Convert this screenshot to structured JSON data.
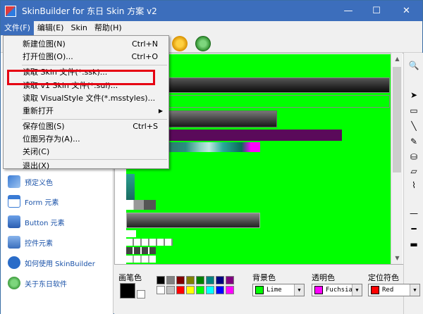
{
  "window": {
    "title": "SkinBuilder for 东日 Skin 方案 v2",
    "minimize": "—",
    "maximize": "☐",
    "close": "✕"
  },
  "menubar": {
    "items": [
      "文件(F)",
      "编辑(E)",
      "Skin",
      "帮助(H)"
    ]
  },
  "file_menu": {
    "items": [
      {
        "label": "新建位图(N)",
        "shortcut": "Ctrl+N"
      },
      {
        "label": "打开位图(O)...",
        "shortcut": "Ctrl+O"
      },
      {
        "label": "读取 Skin 文件(*.ssk)...",
        "shortcut": ""
      },
      {
        "label": "读取 v1 Skin 文件(*.sui)...",
        "shortcut": ""
      },
      {
        "label": "读取 VisualStyle 文件(*.msstyles)...",
        "shortcut": ""
      },
      {
        "label": "重新打开",
        "shortcut": "",
        "submenu": "▶"
      },
      {
        "label": "保存位图(S)",
        "shortcut": "Ctrl+S"
      },
      {
        "label": "位图另存为(A)...",
        "shortcut": ""
      },
      {
        "label": "关闭(C)",
        "shortcut": ""
      },
      {
        "label": "退出(X)",
        "shortcut": ""
      }
    ]
  },
  "left_panel": {
    "items": [
      {
        "label": "预定义色",
        "icon": "palette-icon"
      },
      {
        "label": "Form 元素",
        "icon": "form-icon"
      },
      {
        "label": "Button 元素",
        "icon": "button-icon"
      },
      {
        "label": "控件元素",
        "icon": "control-icon"
      },
      {
        "label": "如何使用 SkinBuilder",
        "icon": "help-icon"
      },
      {
        "label": "关于东日软件",
        "icon": "about-icon"
      }
    ]
  },
  "bottom_bar": {
    "pen_color_label": "画笔色",
    "bg_color_label": "背景色",
    "bg_color_value": "Lime",
    "transparent_label": "透明色",
    "transparent_value": "Fuchsia",
    "locator_label": "定位符色",
    "locator_value": "Red"
  },
  "colors": {
    "title_bar": "#3c6ebc",
    "canvas": "#00ff00",
    "highlight": "#e60012",
    "lime": "#00ff00",
    "fuchsia": "#ff00ff",
    "red": "#ff0000"
  }
}
